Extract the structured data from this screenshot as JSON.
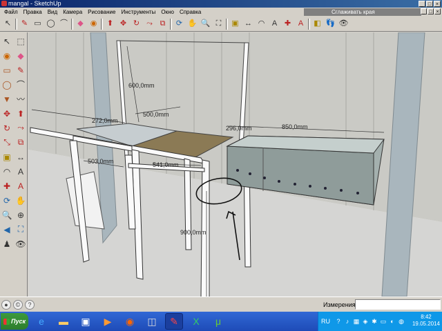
{
  "window": {
    "title": "mangal - SketchUp"
  },
  "menu": {
    "items": [
      "Файл",
      "Правка",
      "Вид",
      "Камера",
      "Рисование",
      "Инструменты",
      "Окно",
      "Справка"
    ],
    "help_field": "Сглаживать края"
  },
  "toolbar_icons": [
    "select-arrow-icon",
    "pencil-icon",
    "rectangle-icon",
    "circle-icon",
    "arc-icon",
    "eraser-icon",
    "paint-bucket-icon",
    "push-pull-icon",
    "move-icon",
    "rotate-icon",
    "follow-me-icon",
    "offset-icon",
    "orbit-icon",
    "pan-icon",
    "zoom-icon",
    "zoom-extents-icon",
    "tape-measure-icon",
    "dimension-icon",
    "protractor-icon",
    "text-icon",
    "axes-icon",
    "3d-text-icon",
    "section-plane-icon",
    "walk-icon",
    "look-around-icon",
    "position-camera-icon"
  ],
  "left_tools": [
    "select-arrow-icon",
    "component-icon",
    "paint-bucket-icon",
    "eraser-icon",
    "rectangle-icon",
    "line-icon",
    "circle-icon",
    "arc-icon",
    "polygon-icon",
    "freehand-icon",
    "move-icon",
    "push-pull-icon",
    "rotate-icon",
    "follow-me-icon",
    "scale-icon",
    "offset-icon",
    "tape-measure-icon",
    "dimension-icon",
    "protractor-icon",
    "text-icon",
    "axes-icon",
    "3d-text-icon",
    "orbit-icon",
    "pan-icon",
    "zoom-icon",
    "zoom-window-icon",
    "previous-view-icon",
    "zoom-extents-icon",
    "position-camera-icon",
    "look-around-icon"
  ],
  "dimensions": {
    "d600": "600,0mm",
    "d500": "500,0mm",
    "d272": "272,0mm",
    "d296": "296,0mm",
    "d850": "850,0mm",
    "d503": "503,0mm",
    "d541": "541,0mm",
    "d900": "900,0mm"
  },
  "status": {
    "measurements_label": "Измерения",
    "measurements_value": ""
  },
  "taskbar": {
    "start_label": "Пуск",
    "tasks": [
      "ie-icon",
      "folder-icon",
      "save-icon",
      "media-icon",
      "firefox-icon",
      "app-icon",
      "sketchup-icon",
      "excel-icon",
      "utorrent-icon"
    ],
    "lang": "RU",
    "time": "8:42",
    "date": "19.05.2014"
  },
  "colors": {
    "wall": "#c9c9c4",
    "floor": "#d3d3d3",
    "grill_metal": "#9aa7a5",
    "wood": "#8c7a55",
    "title_bar": "#0a246a"
  }
}
